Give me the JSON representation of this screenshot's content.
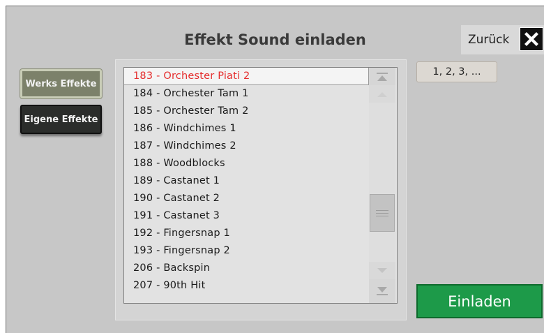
{
  "dialog": {
    "title": "Effekt Sound einladen",
    "back_label": "Zurück",
    "close_icon": "close-icon"
  },
  "sidebar": {
    "werks_label": "Werks Effekte",
    "eigene_label": "Eigene Effekte"
  },
  "list": {
    "items": [
      "183 - Orchester Piati 2",
      "184 - Orchester Tam 1",
      "185 - Orchester Tam 2",
      "186 - Windchimes 1",
      "187 - Windchimes 2",
      "188 - Woodblocks",
      "189 - Castanet 1",
      "190 - Castanet 2",
      "191 - Castanet 3",
      "192 - Fingersnap 1",
      "193 - Fingersnap 2",
      "206 - Backspin",
      "207 - 90th Hit"
    ],
    "selected_index": 0,
    "selected_color": "#e52e2e"
  },
  "numpad_label": "1, 2, 3, ...",
  "load_label": "Einladen",
  "colors": {
    "accent_green": "#1d9a49",
    "werks_button": "#7c816a",
    "eigene_button": "#2b2d2b"
  }
}
